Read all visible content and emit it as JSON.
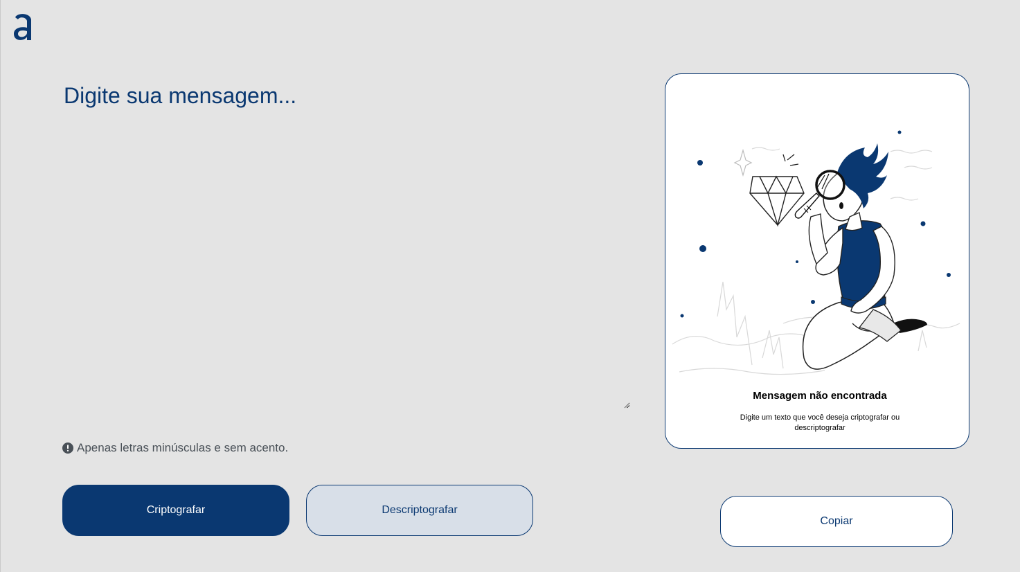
{
  "app": {
    "logo_icon": "alura-a-logo-icon"
  },
  "input": {
    "placeholder": "Digite sua mensagem...",
    "value": ""
  },
  "hint": {
    "icon": "exclamation-circle-icon",
    "text": "Apenas letras minúsculas e sem acento."
  },
  "buttons": {
    "encrypt_label": "Criptografar",
    "decrypt_label": "Descriptografar",
    "copy_label": "Copiar"
  },
  "output": {
    "illustration": "person-with-magnifying-glass-and-diamond",
    "title": "Mensagem não encontrada",
    "subtitle": "Digite um texto que você deseja criptografar ou descriptografar"
  },
  "colors": {
    "primary": "#0a3871",
    "background": "#e4e4e4",
    "secondary_button_bg": "#d8dfe8",
    "card_bg": "#ffffff",
    "hint_text": "#495057"
  }
}
